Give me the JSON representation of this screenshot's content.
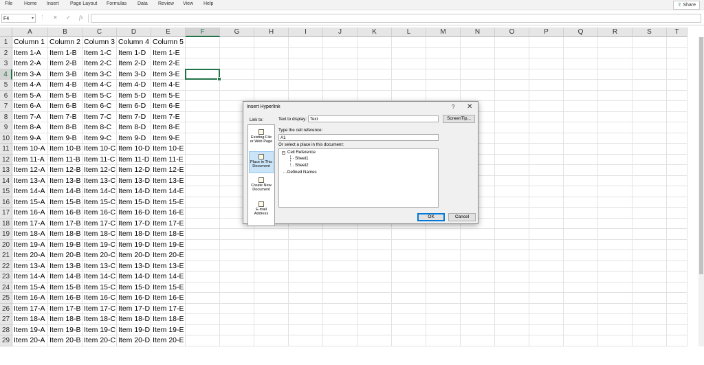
{
  "ribbon": {
    "tabs": [
      "File",
      "Home",
      "Insert",
      "Page Layout",
      "Formulas",
      "Data",
      "Review",
      "View",
      "Help"
    ],
    "share_label": "Share"
  },
  "formula_bar": {
    "name_box": "F4",
    "formula": ""
  },
  "sheet": {
    "columns": [
      "A",
      "B",
      "C",
      "D",
      "E",
      "F",
      "G",
      "H",
      "I",
      "J",
      "K",
      "L",
      "M",
      "N",
      "O",
      "P",
      "Q",
      "R",
      "S",
      "T"
    ],
    "selected_column": "F",
    "selected_row": 4,
    "rows": [
      [
        "Column 1",
        "Column 2",
        "Column 3",
        "Column 4",
        "Column 5"
      ],
      [
        "Item 1-A",
        "Item 1-B",
        "Item 1-C",
        "Item 1-D",
        "Item 1-E"
      ],
      [
        "Item 2-A",
        "Item 2-B",
        "Item 2-C",
        "Item 2-D",
        "Item 2-E"
      ],
      [
        "Item 3-A",
        "Item 3-B",
        "Item 3-C",
        "Item 3-D",
        "Item 3-E"
      ],
      [
        "Item 4-A",
        "Item 4-B",
        "Item 4-C",
        "Item 4-D",
        "Item 4-E"
      ],
      [
        "Item 5-A",
        "Item 5-B",
        "Item 5-C",
        "Item 5-D",
        "Item 5-E"
      ],
      [
        "Item 6-A",
        "Item 6-B",
        "Item 6-C",
        "Item 6-D",
        "Item 6-E"
      ],
      [
        "Item 7-A",
        "Item 7-B",
        "Item 7-C",
        "Item 7-D",
        "Item 7-E"
      ],
      [
        "Item 8-A",
        "Item 8-B",
        "Item 8-C",
        "Item 8-D",
        "Item 8-E"
      ],
      [
        "Item 9-A",
        "Item 9-B",
        "Item 9-C",
        "Item 9-D",
        "Item 9-E"
      ],
      [
        "Item 10-A",
        "Item 10-B",
        "Item 10-C",
        "Item 10-D",
        "Item 10-E"
      ],
      [
        "Item 11-A",
        "Item 11-B",
        "Item 11-C",
        "Item 11-D",
        "Item 11-E"
      ],
      [
        "Item 12-A",
        "Item 12-B",
        "Item 12-C",
        "Item 12-D",
        "Item 12-E"
      ],
      [
        "Item 13-A",
        "Item 13-B",
        "Item 13-C",
        "Item 13-D",
        "Item 13-E"
      ],
      [
        "Item 14-A",
        "Item 14-B",
        "Item 14-C",
        "Item 14-D",
        "Item 14-E"
      ],
      [
        "Item 15-A",
        "Item 15-B",
        "Item 15-C",
        "Item 15-D",
        "Item 15-E"
      ],
      [
        "Item 16-A",
        "Item 16-B",
        "Item 16-C",
        "Item 16-D",
        "Item 16-E"
      ],
      [
        "Item 17-A",
        "Item 17-B",
        "Item 17-C",
        "Item 17-D",
        "Item 17-E"
      ],
      [
        "Item 18-A",
        "Item 18-B",
        "Item 18-C",
        "Item 18-D",
        "Item 18-E"
      ],
      [
        "Item 19-A",
        "Item 19-B",
        "Item 19-C",
        "Item 19-D",
        "Item 19-E"
      ],
      [
        "Item 20-A",
        "Item 20-B",
        "Item 20-C",
        "Item 20-D",
        "Item 20-E"
      ],
      [
        "Item 13-A",
        "Item 13-B",
        "Item 13-C",
        "Item 13-D",
        "Item 13-E"
      ],
      [
        "Item 14-A",
        "Item 14-B",
        "Item 14-C",
        "Item 14-D",
        "Item 14-E"
      ],
      [
        "Item 15-A",
        "Item 15-B",
        "Item 15-C",
        "Item 15-D",
        "Item 15-E"
      ],
      [
        "Item 16-A",
        "Item 16-B",
        "Item 16-C",
        "Item 16-D",
        "Item 16-E"
      ],
      [
        "Item 17-A",
        "Item 17-B",
        "Item 17-C",
        "Item 17-D",
        "Item 17-E"
      ],
      [
        "Item 18-A",
        "Item 18-B",
        "Item 18-C",
        "Item 18-D",
        "Item 18-E"
      ],
      [
        "Item 19-A",
        "Item 19-B",
        "Item 19-C",
        "Item 19-D",
        "Item 19-E"
      ],
      [
        "Item 20-A",
        "Item 20-B",
        "Item 20-C",
        "Item 20-D",
        "Item 20-E"
      ]
    ]
  },
  "dialog": {
    "title": "Insert Hyperlink",
    "help": "?",
    "close": "✕",
    "link_to_label": "Link to:",
    "link_items": [
      "Existing File or Web Page",
      "Place in This Document",
      "Create New Document",
      "E-mail Address"
    ],
    "text_to_display_label": "Text to display:",
    "text_to_display_value": "Text",
    "screentip_label": "ScreenTip...",
    "cell_ref_label": "Type the cell reference:",
    "cell_ref_value": "A1",
    "select_place_label": "Or select a place in this document:",
    "tree": {
      "cell_reference": "Cell Reference",
      "sheets": [
        "Sheet1",
        "Sheet2"
      ],
      "defined_names": "Defined Names"
    },
    "ok_label": "OK",
    "cancel_label": "Cancel"
  }
}
